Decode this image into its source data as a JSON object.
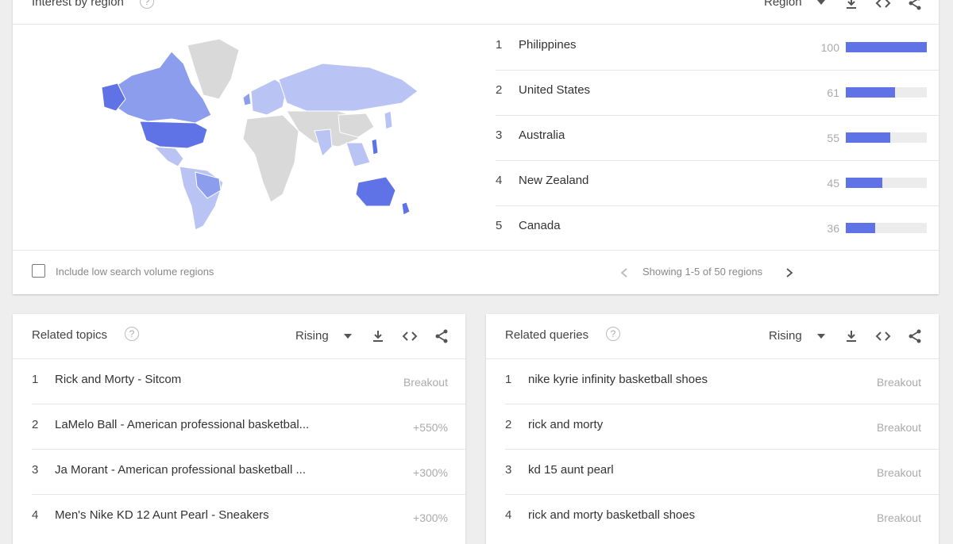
{
  "interest_by_region": {
    "title": "Interest by region",
    "resolution_label": "Region",
    "rows": [
      {
        "rank": "1",
        "name": "Philippines",
        "value": "100",
        "fraction": 1.0
      },
      {
        "rank": "2",
        "name": "United States",
        "value": "61",
        "fraction": 0.61
      },
      {
        "rank": "3",
        "name": "Australia",
        "value": "55",
        "fraction": 0.55
      },
      {
        "rank": "4",
        "name": "New Zealand",
        "value": "45",
        "fraction": 0.45
      },
      {
        "rank": "5",
        "name": "Canada",
        "value": "36",
        "fraction": 0.36
      }
    ],
    "checkbox_label": "Include low search volume regions",
    "pagination": "Showing 1-5 of 50 regions"
  },
  "related_topics": {
    "title": "Related topics",
    "filter": "Rising",
    "rows": [
      {
        "rank": "1",
        "name": "Rick and Morty - Sitcom",
        "value": "Breakout"
      },
      {
        "rank": "2",
        "name": "LaMelo Ball - American professional basketbal...",
        "value": "+550%"
      },
      {
        "rank": "3",
        "name": "Ja Morant - American professional basketball ...",
        "value": "+300%"
      },
      {
        "rank": "4",
        "name": "Men's Nike KD 12 Aunt Pearl - Sneakers",
        "value": "+300%"
      }
    ]
  },
  "related_queries": {
    "title": "Related queries",
    "filter": "Rising",
    "rows": [
      {
        "rank": "1",
        "name": "nike kyrie infinity basketball shoes",
        "value": "Breakout"
      },
      {
        "rank": "2",
        "name": "rick and morty",
        "value": "Breakout"
      },
      {
        "rank": "3",
        "name": "kd 15 aunt pearl",
        "value": "Breakout"
      },
      {
        "rank": "4",
        "name": "rick and morty basketball shoes",
        "value": "Breakout"
      }
    ]
  },
  "colors": {
    "accent": "#5f72e6",
    "map_high": "#5f72e6",
    "map_mid": "#8c9ded",
    "map_low": "#b9c4f4",
    "map_none": "#d9d9d9"
  },
  "icons": [
    "help-icon",
    "download-icon",
    "embed-icon",
    "share-icon",
    "chevron-left-icon",
    "chevron-right-icon",
    "dropdown-caret-icon"
  ]
}
